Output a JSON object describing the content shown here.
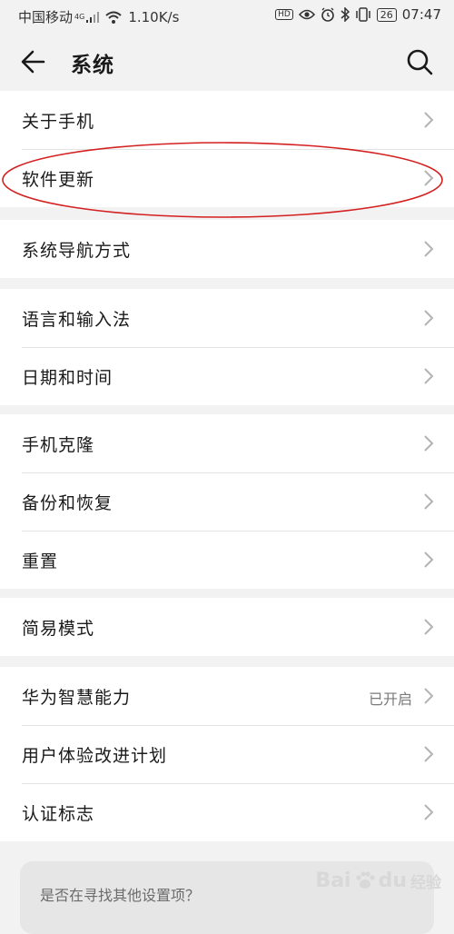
{
  "status_bar": {
    "carrier": "中国移动",
    "network_badge": "4G",
    "speed": "1.10K/s",
    "hd_badge": "HD",
    "battery": "26",
    "time": "07:47",
    "icons": [
      "signal-icon",
      "wifi-icon",
      "eye-icon",
      "alarm-icon",
      "bluetooth-icon",
      "vibrate-icon",
      "battery-icon"
    ]
  },
  "header": {
    "title": "系统",
    "back_icon": "back-arrow-icon",
    "search_icon": "search-icon"
  },
  "groups": [
    {
      "items": [
        {
          "label": "关于手机"
        },
        {
          "label": "软件更新"
        }
      ]
    },
    {
      "items": [
        {
          "label": "系统导航方式"
        }
      ]
    },
    {
      "items": [
        {
          "label": "语言和输入法"
        },
        {
          "label": "日期和时间"
        }
      ]
    },
    {
      "items": [
        {
          "label": "手机克隆"
        },
        {
          "label": "备份和恢复"
        },
        {
          "label": "重置"
        }
      ]
    },
    {
      "items": [
        {
          "label": "简易模式"
        }
      ]
    },
    {
      "items": [
        {
          "label": "华为智慧能力",
          "value": "已开启"
        },
        {
          "label": "用户体验改进计划"
        },
        {
          "label": "认证标志"
        }
      ]
    }
  ],
  "bottom_card": {
    "prompt": "是否在寻找其他设置项？"
  },
  "annotation": {
    "color": "#d42020",
    "target": "软件更新"
  },
  "watermark": {
    "brand": "Bai",
    "brand_end": "du",
    "sub": "经验"
  },
  "colors": {
    "background": "#f2f2f2",
    "card": "#ffffff",
    "chevron": "#b3b3b3",
    "value_text": "#7a7a7a"
  }
}
